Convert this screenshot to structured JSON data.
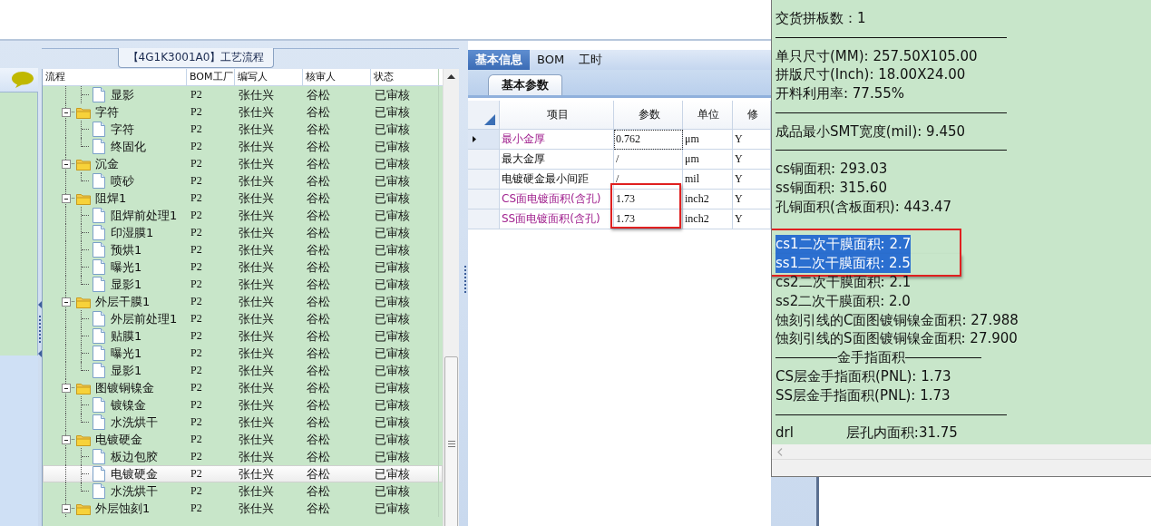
{
  "flow_group": {
    "title": "【4G1K3001A0】工艺流程"
  },
  "tree_columns": [
    "流程",
    "BOM工厂",
    "编写人",
    "核审人",
    "状态"
  ],
  "tree": [
    {
      "kind": "file",
      "name": "显影",
      "factory": "P2",
      "writer": "张仕兴",
      "reviewer": "谷松",
      "status": "已审核",
      "selected": false
    },
    {
      "kind": "folder",
      "name": "字符",
      "factory": "P2",
      "writer": "张仕兴",
      "reviewer": "谷松",
      "status": "已审核",
      "selected": false,
      "expanded": true,
      "children": [
        {
          "kind": "file",
          "name": "字符",
          "factory": "P2",
          "writer": "张仕兴",
          "reviewer": "谷松",
          "status": "已审核",
          "selected": false
        },
        {
          "kind": "file",
          "name": "终固化",
          "factory": "P2",
          "writer": "张仕兴",
          "reviewer": "谷松",
          "status": "已审核",
          "selected": false
        }
      ]
    },
    {
      "kind": "folder",
      "name": "沉金",
      "factory": "P2",
      "writer": "张仕兴",
      "reviewer": "谷松",
      "status": "已审核",
      "selected": false,
      "expanded": true,
      "children": [
        {
          "kind": "file",
          "name": "喷砂",
          "factory": "P2",
          "writer": "张仕兴",
          "reviewer": "谷松",
          "status": "已审核",
          "selected": false
        }
      ]
    },
    {
      "kind": "folder",
      "name": "阻焊1",
      "factory": "P2",
      "writer": "张仕兴",
      "reviewer": "谷松",
      "status": "已审核",
      "selected": false,
      "expanded": true,
      "children": [
        {
          "kind": "file",
          "name": "阻焊前处理1",
          "factory": "P2",
          "writer": "张仕兴",
          "reviewer": "谷松",
          "status": "已审核",
          "selected": false
        },
        {
          "kind": "file",
          "name": "印湿膜1",
          "factory": "P2",
          "writer": "张仕兴",
          "reviewer": "谷松",
          "status": "已审核",
          "selected": false
        },
        {
          "kind": "file",
          "name": "预烘1",
          "factory": "P2",
          "writer": "张仕兴",
          "reviewer": "谷松",
          "status": "已审核",
          "selected": false
        },
        {
          "kind": "file",
          "name": "曝光1",
          "factory": "P2",
          "writer": "张仕兴",
          "reviewer": "谷松",
          "status": "已审核",
          "selected": false
        },
        {
          "kind": "file",
          "name": "显影1",
          "factory": "P2",
          "writer": "张仕兴",
          "reviewer": "谷松",
          "status": "已审核",
          "selected": false
        }
      ]
    },
    {
      "kind": "folder",
      "name": "外层干膜1",
      "factory": "P2",
      "writer": "张仕兴",
      "reviewer": "谷松",
      "status": "已审核",
      "selected": false,
      "expanded": true,
      "children": [
        {
          "kind": "file",
          "name": "外层前处理1",
          "factory": "P2",
          "writer": "张仕兴",
          "reviewer": "谷松",
          "status": "已审核",
          "selected": false
        },
        {
          "kind": "file",
          "name": "贴膜1",
          "factory": "P2",
          "writer": "张仕兴",
          "reviewer": "谷松",
          "status": "已审核",
          "selected": false
        },
        {
          "kind": "file",
          "name": "曝光1",
          "factory": "P2",
          "writer": "张仕兴",
          "reviewer": "谷松",
          "status": "已审核",
          "selected": false
        },
        {
          "kind": "file",
          "name": "显影1",
          "factory": "P2",
          "writer": "张仕兴",
          "reviewer": "谷松",
          "status": "已审核",
          "selected": false
        }
      ]
    },
    {
      "kind": "folder",
      "name": "图镀铜镍金",
      "factory": "P2",
      "writer": "张仕兴",
      "reviewer": "谷松",
      "status": "已审核",
      "selected": false,
      "expanded": true,
      "children": [
        {
          "kind": "file",
          "name": "镀镍金",
          "factory": "P2",
          "writer": "张仕兴",
          "reviewer": "谷松",
          "status": "已审核",
          "selected": false
        },
        {
          "kind": "file",
          "name": "水洗烘干",
          "factory": "P2",
          "writer": "张仕兴",
          "reviewer": "谷松",
          "status": "已审核",
          "selected": false
        }
      ]
    },
    {
      "kind": "folder",
      "name": "电镀硬金",
      "factory": "P2",
      "writer": "张仕兴",
      "reviewer": "谷松",
      "status": "已审核",
      "selected": false,
      "expanded": true,
      "children": [
        {
          "kind": "file",
          "name": "板边包胶",
          "factory": "P2",
          "writer": "张仕兴",
          "reviewer": "谷松",
          "status": "已审核",
          "selected": false
        },
        {
          "kind": "file",
          "name": "电镀硬金",
          "factory": "P2",
          "writer": "张仕兴",
          "reviewer": "谷松",
          "status": "已审核",
          "selected": true
        },
        {
          "kind": "file",
          "name": "水洗烘干",
          "factory": "P2",
          "writer": "张仕兴",
          "reviewer": "谷松",
          "status": "已审核",
          "selected": false
        }
      ]
    },
    {
      "kind": "folder",
      "name": "外层蚀刻1",
      "factory": "P2",
      "writer": "张仕兴",
      "reviewer": "谷松",
      "status": "已审核",
      "selected": false,
      "expanded": true
    }
  ],
  "tabs": [
    {
      "label": "基本信息",
      "selected": true
    },
    {
      "label": "BOM",
      "selected": false
    },
    {
      "label": "工时",
      "selected": false
    }
  ],
  "subtab": {
    "label": "基本参数"
  },
  "param_columns": [
    "项目",
    "参数",
    "单位",
    "修"
  ],
  "params": [
    {
      "item": "最小金厚",
      "value": "0.762",
      "unit": "μm",
      "modify": "Y",
      "highlighted": true,
      "current": true,
      "annotated": false
    },
    {
      "item": "最大金厚",
      "value": "/",
      "unit": "μm",
      "modify": "Y",
      "highlighted": false,
      "current": false,
      "annotated": false
    },
    {
      "item": "电镀硬金最小间距",
      "value": "/",
      "unit": "mil",
      "modify": "Y",
      "highlighted": false,
      "current": false,
      "annotated": false
    },
    {
      "item": "CS面电镀面积(含孔)",
      "value": "1.73",
      "unit": "inch2",
      "modify": "Y",
      "highlighted": true,
      "current": false,
      "annotated": true
    },
    {
      "item": "SS面电镀面积(含孔)",
      "value": "1.73",
      "unit": "inch2",
      "modify": "Y",
      "highlighted": true,
      "current": false,
      "annotated": true
    }
  ],
  "info_lines": [
    {
      "kind": "text",
      "text": "交货拼板数：1",
      "selected": false,
      "annotated": false
    },
    {
      "kind": "rule"
    },
    {
      "kind": "text",
      "text": "单只尺寸(MM): 257.50X105.00",
      "selected": false,
      "annotated": false
    },
    {
      "kind": "text",
      "text": "拼版尺寸(Inch): 18.00X24.00",
      "selected": false,
      "annotated": false
    },
    {
      "kind": "text",
      "text": "开料利用率: 77.55%",
      "selected": false,
      "annotated": false
    },
    {
      "kind": "rule"
    },
    {
      "kind": "text",
      "text": "成品最小SMT宽度(mil): 9.450",
      "selected": false,
      "annotated": false
    },
    {
      "kind": "rule"
    },
    {
      "kind": "text",
      "text": "cs铜面积: 293.03",
      "selected": false,
      "annotated": false
    },
    {
      "kind": "text",
      "text": "ss铜面积: 315.60",
      "selected": false,
      "annotated": false
    },
    {
      "kind": "text",
      "text": "孔铜面积(含板面积): 443.47",
      "selected": false,
      "annotated": false
    },
    {
      "kind": "blank"
    },
    {
      "kind": "text",
      "text": "cs1二次干膜面积: 2.7",
      "selected": true,
      "annotated": true
    },
    {
      "kind": "text",
      "text": "ss1二次干膜面积: 2.5",
      "selected": true,
      "annotated": true
    },
    {
      "kind": "text",
      "text": "cs2二次干膜面积: 2.1",
      "selected": false,
      "annotated": false
    },
    {
      "kind": "text",
      "text": "ss2二次干膜面积: 2.0",
      "selected": false,
      "annotated": false
    },
    {
      "kind": "text",
      "text": "蚀刻引线的C面图镀铜镍金面积: 27.988",
      "selected": false,
      "annotated": false
    },
    {
      "kind": "text",
      "text": "蚀刻引线的S面图镀铜镍金面积: 27.900",
      "selected": false,
      "annotated": false
    },
    {
      "kind": "heading",
      "text": "金手指面积"
    },
    {
      "kind": "text",
      "text": "CS层金手指面积(PNL): 1.73",
      "selected": false,
      "annotated": false
    },
    {
      "kind": "text",
      "text": "SS层金手指面积(PNL): 1.73",
      "selected": false,
      "annotated": false
    },
    {
      "kind": "rule"
    },
    {
      "kind": "split",
      "parts": [
        "drl",
        "层孔内面积:31.75"
      ]
    }
  ]
}
